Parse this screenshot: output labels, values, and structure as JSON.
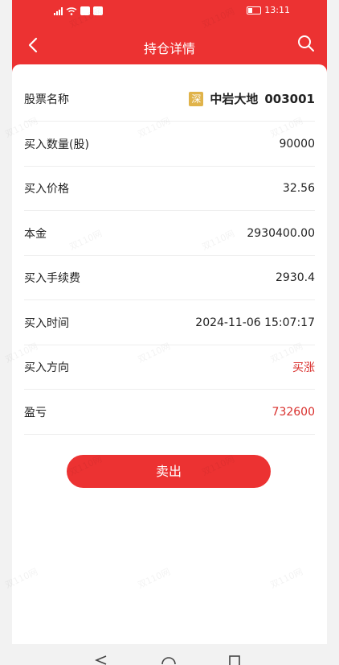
{
  "status_bar": {
    "time": "13:11"
  },
  "nav": {
    "title": "持仓详情"
  },
  "details": {
    "stock_name_label": "股票名称",
    "exchange_badge": "深",
    "stock_name": "中岩大地",
    "stock_code": "003001",
    "quantity_label": "买入数量(股)",
    "quantity": "90000",
    "price_label": "买入价格",
    "price": "32.56",
    "principal_label": "本金",
    "principal": "2930400.00",
    "fee_label": "买入手续费",
    "fee": "2930.4",
    "time_label": "买入时间",
    "time": "2024-11-06 15:07:17",
    "direction_label": "买入方向",
    "direction": "买涨",
    "pnl_label": "盈亏",
    "pnl": "732600"
  },
  "actions": {
    "sell_label": "卖出"
  },
  "watermark": "双110网",
  "colors": {
    "primary": "#ec3232",
    "badge": "#e0b34a",
    "red_text": "#d9302d"
  }
}
